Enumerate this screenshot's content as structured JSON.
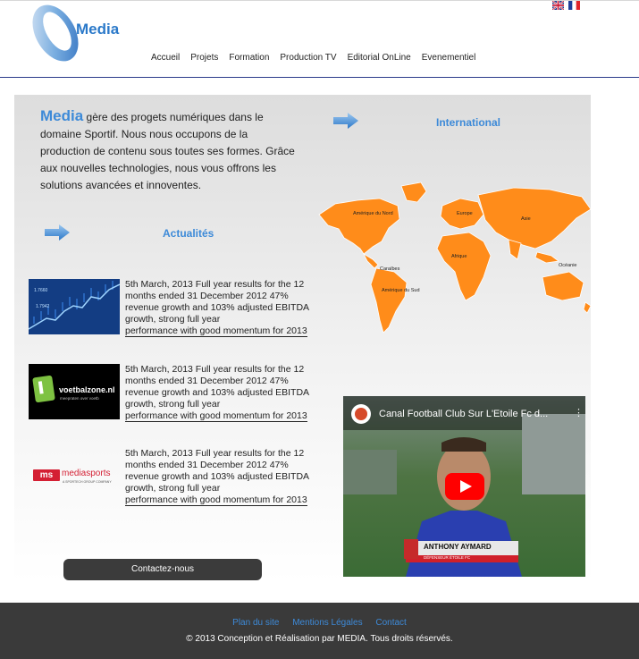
{
  "header": {
    "logo_text": "Media",
    "nav": [
      "Accueil",
      "Projets",
      "Formation",
      "Production TV",
      "Editorial OnLine",
      "Evenementiel"
    ]
  },
  "intro": {
    "brand": "Media",
    "text": " gère des progets numériques dans le domaine Sportif. Nous nous occupons de la production de contenu sous toutes ses formes. Grâce aux nouvelles technologies, nous vous offrons les solutions avancées et innoventes."
  },
  "sections": {
    "news_title": "Actualités",
    "international_title": "International"
  },
  "news": [
    {
      "line1": "5th March, 2013 Full year results for the 12 months ended 31 December 2012 47% revenue growth and 103% adjusted EBITDA growth, strong full year",
      "line2": "performance with good momentum for 2013",
      "thumb": "stock-chart"
    },
    {
      "line1": "5th March, 2013 Full year results for the 12 months ended 31 December 2012 47% revenue growth and 103% adjusted EBITDA growth, strong full year",
      "line2": "performance with good momentum for 2013",
      "thumb": "voetbalzone"
    },
    {
      "line1": "5th March, 2013 Full year results for the 12 months ended 31 December 2012 47% revenue growth and 103% adjusted EBITDA growth, strong full year",
      "line2": "performance with good momentum for 2013",
      "thumb": "mediasports"
    }
  ],
  "thumbs": {
    "voetbalzone_brand": "voetbalzone.nl",
    "voetbalzone_tag": "meepraten over voetb",
    "mediasports_brand": "mediasports",
    "mediasports_tag": "A SPORTECH GROUP COMPANY"
  },
  "map_labels": {
    "na": "Amérique du Nord",
    "sa": "Amérique du Sud",
    "carib": "Caraïbes",
    "europe": "Europe",
    "africa": "Afrique",
    "asia": "Asie",
    "oceania": "Océanie"
  },
  "contact_button": "Contactez-nous",
  "video": {
    "title": "Canal Football Club Sur L'Etoile Fc d...",
    "player_name": "ANTHONY AYMARD",
    "player_role": "DÉFENSEUR ÉTOILE FC"
  },
  "footer": {
    "links": [
      "Plan du site",
      "Mentions Légales",
      "Contact"
    ],
    "copyright": "© 2013 Conception et Réalisation par MEDIA. Tous droits réservés."
  },
  "colors": {
    "accent": "#3d8ad8",
    "map_orange": "#ff8c1a",
    "footer_bg": "#3a3a3a",
    "button_bg": "#3b3b3b"
  }
}
